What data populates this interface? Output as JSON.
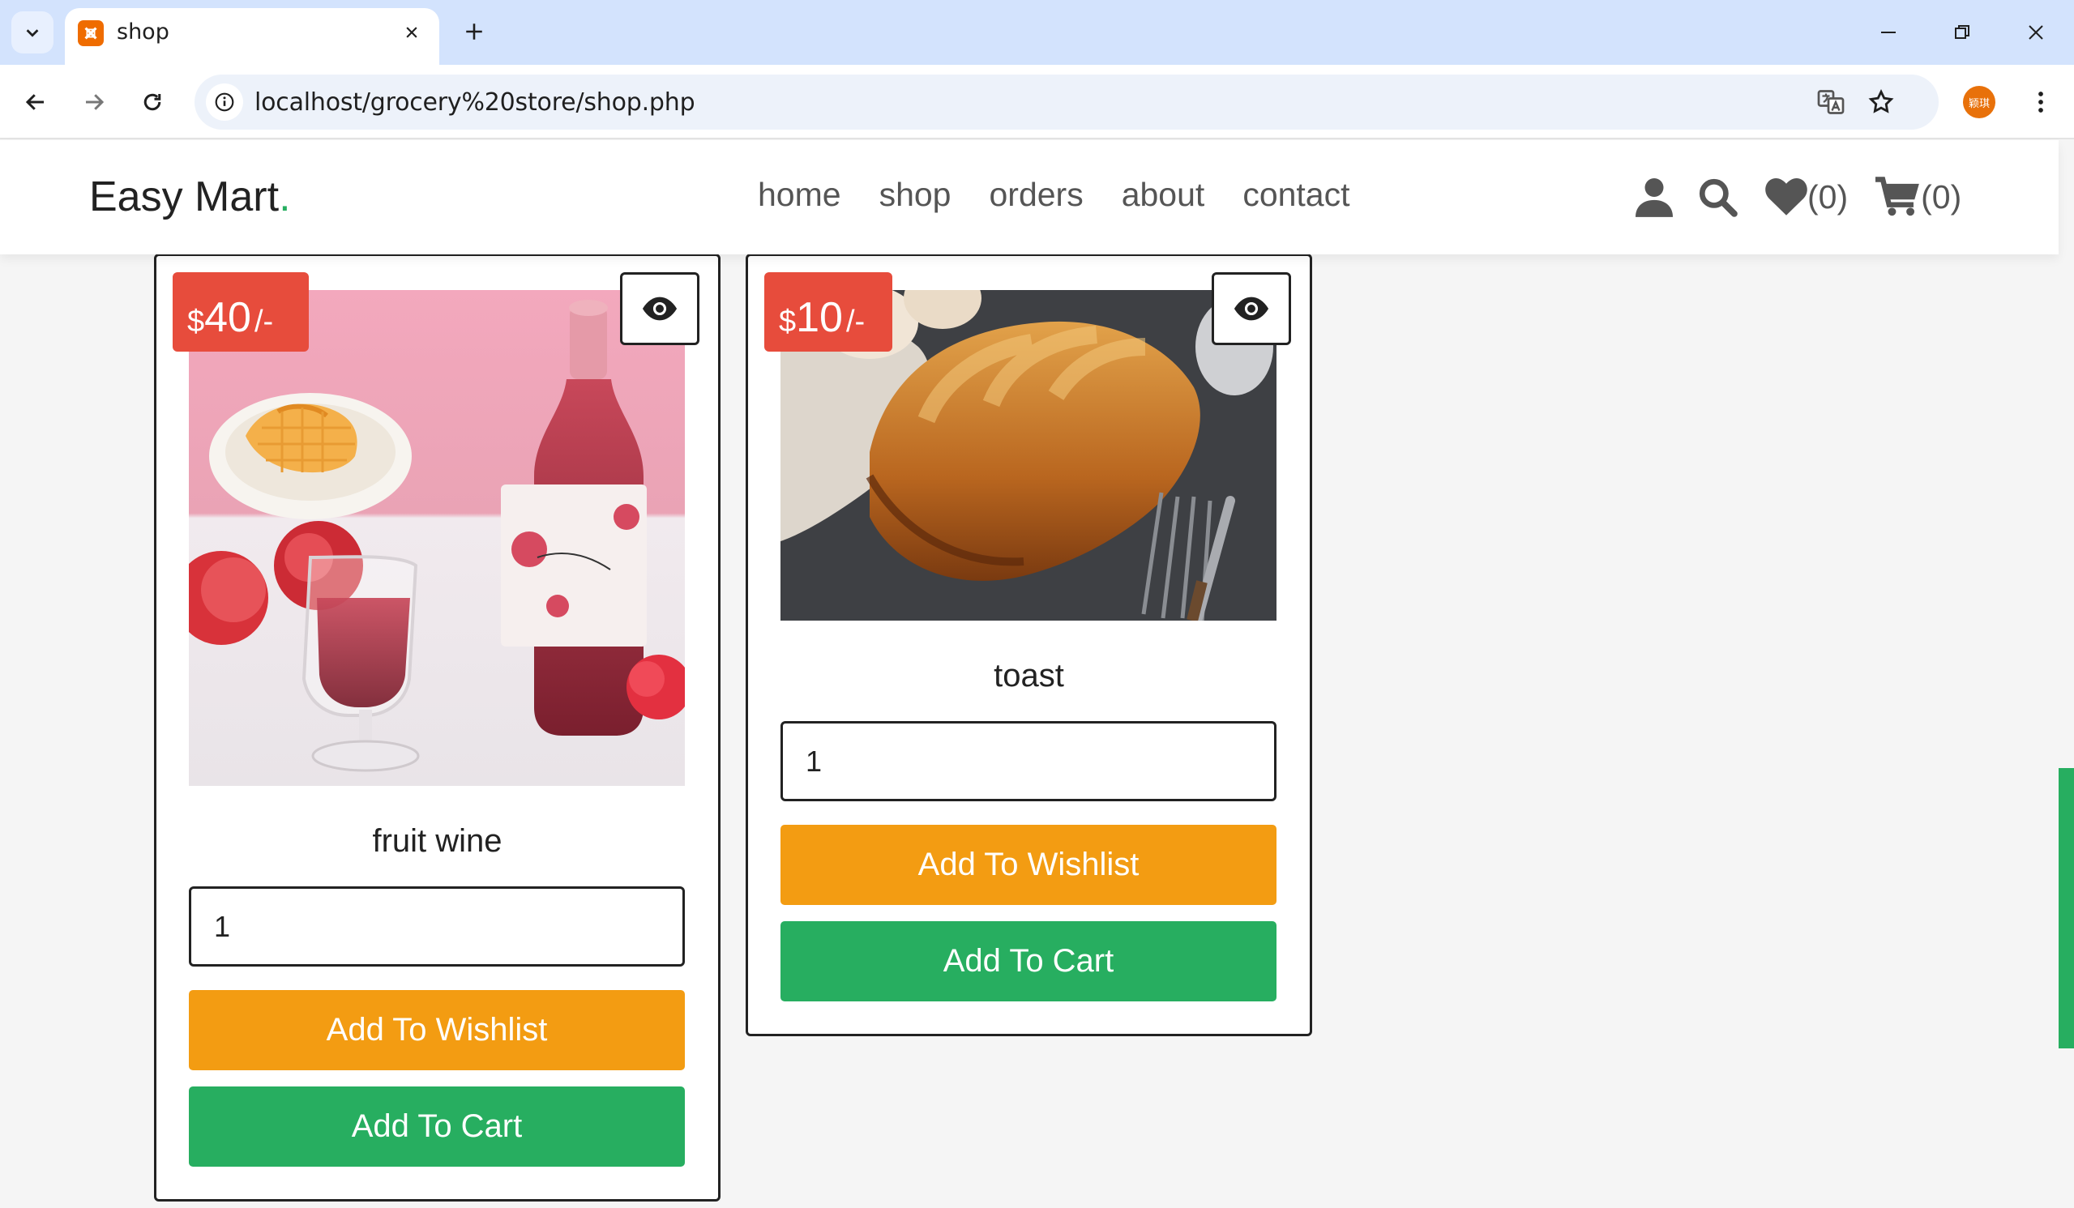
{
  "browser": {
    "tab_title": "shop",
    "url": "localhost/grocery%20store/shop.php",
    "profile_initials": "颖琪"
  },
  "site": {
    "logo_text": "Easy Mart",
    "logo_dot": ".",
    "nav": [
      "home",
      "shop",
      "orders",
      "about",
      "contact"
    ],
    "wishlist_count": "(0)",
    "cart_count": "(0)"
  },
  "products": [
    {
      "name": "fruit wine",
      "price_currency": "$",
      "price_amount": "40",
      "price_suffix": "/-",
      "quantity": "1",
      "wishlist_label": "Add To Wishlist",
      "cart_label": "Add To Cart"
    },
    {
      "name": "toast",
      "price_currency": "$",
      "price_amount": "10",
      "price_suffix": "/-",
      "quantity": "1",
      "wishlist_label": "Add To Wishlist",
      "cart_label": "Add To Cart"
    }
  ],
  "colors": {
    "accent_green": "#27ae60",
    "price_red": "#e74c3c",
    "wishlist_orange": "#f39c12"
  }
}
